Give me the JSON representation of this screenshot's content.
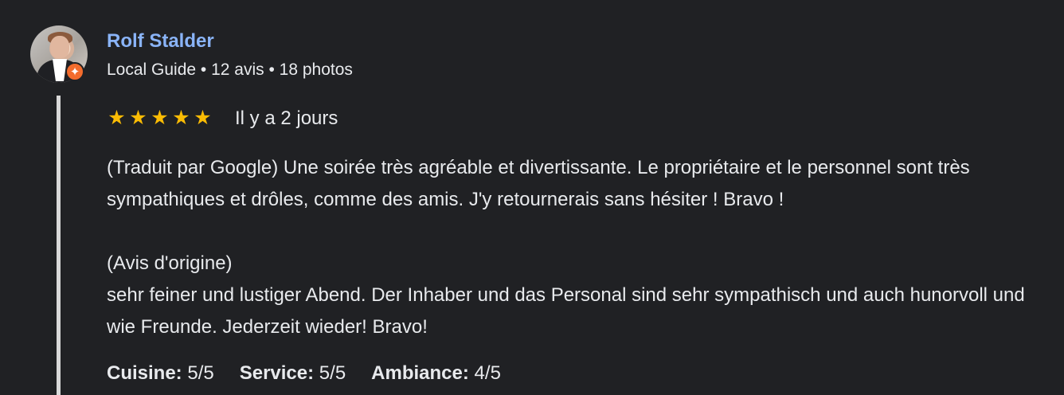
{
  "review": {
    "reviewer": {
      "name": "Rolf Stalder",
      "meta": "Local Guide • 12 avis • 18 photos",
      "avatar_icon": "profile-photo",
      "badge_icon": "local-guide-star",
      "badge_color": "#F36C2D"
    },
    "rating": {
      "stars": 5,
      "star_color": "#FBBC04",
      "date": "Il y a 2 jours"
    },
    "text": {
      "translated": "(Traduit par Google) Une soirée très agréable et divertissante. Le propriétaire et le personnel sont très sympathiques et drôles, comme des amis. J'y retournerais sans hésiter ! Bravo !",
      "original_heading": "(Avis d'origine)",
      "original": "sehr feiner und lustiger Abend. Der Inhaber und das Personal sind sehr sympathisch und auch hunorvoll und wie Freunde. Jederzeit wieder! Bravo!"
    },
    "scores": [
      {
        "label": "Cuisine:",
        "value": "5/5"
      },
      {
        "label": "Service:",
        "value": "5/5"
      },
      {
        "label": "Ambiance:",
        "value": "4/5"
      }
    ]
  },
  "theme": {
    "background": "#202124",
    "text": "#E8EAED",
    "name": "#8AB4F8",
    "thread_line": "#D9D9D9"
  }
}
